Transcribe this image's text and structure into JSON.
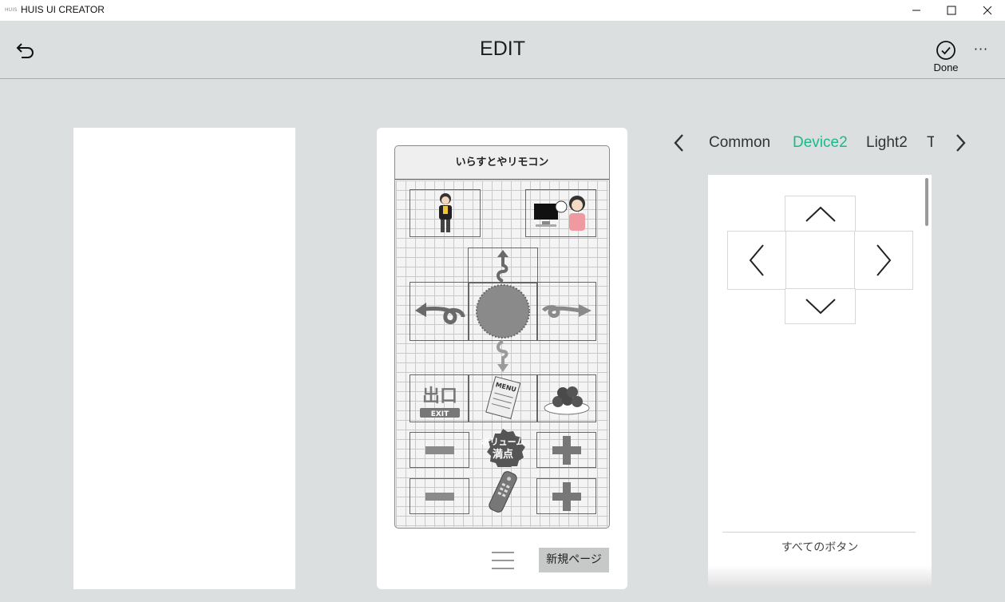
{
  "window": {
    "logo_text": "HUIS",
    "title": "HUIS UI CREATOR"
  },
  "header": {
    "title": "EDIT",
    "done_label": "Done",
    "more_label": "···"
  },
  "remote": {
    "title": "いらすとやリモコン",
    "new_page_label": "新規ページ"
  },
  "category_tabs": {
    "items": [
      "Common",
      "Device2",
      "Light2",
      "T"
    ],
    "active_index": 1
  },
  "palette": {
    "all_buttons_label": "すべてのボタン"
  },
  "colors": {
    "accent_active_tab": "#1bb98a",
    "background": "#dcdfdf"
  }
}
